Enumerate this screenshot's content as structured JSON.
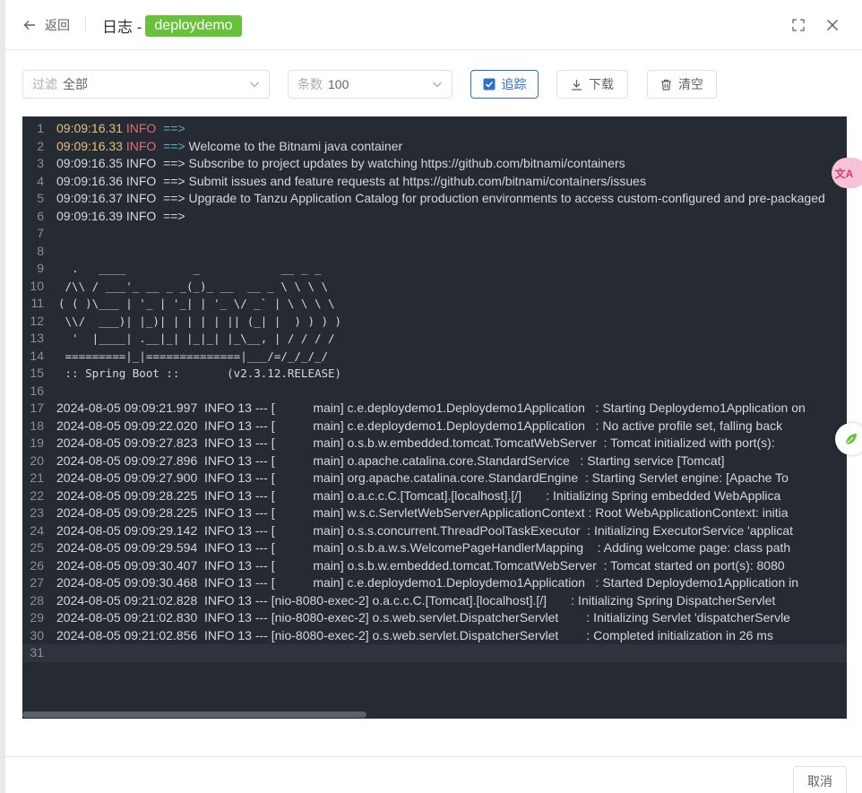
{
  "header": {
    "back_label": "返回",
    "title": "日志 -",
    "tag": "deploydemo",
    "tag_color": "#67c23a"
  },
  "toolbar": {
    "filter": {
      "label": "过滤",
      "value": "全部"
    },
    "count": {
      "label": "条数",
      "value": "100"
    },
    "follow_label": "追踪",
    "download_label": "下载",
    "clear_label": "清空",
    "accent_color": "#2f6fce"
  },
  "log": {
    "background": "#262a33",
    "lines": [
      {
        "n": "1",
        "ts": "09:09:16.31",
        "lvl": "INFO",
        "arrow": "==>",
        "text": "",
        "style": "color"
      },
      {
        "n": "2",
        "ts": "09:09:16.33",
        "lvl": "INFO",
        "arrow": "==>",
        "text": " Welcome to the Bitnami java container",
        "style": "color"
      },
      {
        "n": "3",
        "text": "09:09:16.35 INFO  ==> Subscribe to project updates by watching https://github.com/bitnami/containers"
      },
      {
        "n": "4",
        "text": "09:09:16.36 INFO  ==> Submit issues and feature requests at https://github.com/bitnami/containers/issues"
      },
      {
        "n": "5",
        "text": "09:09:16.37 INFO  ==> Upgrade to Tanzu Application Catalog for production environments to access custom-configured and pre-packaged"
      },
      {
        "n": "6",
        "text": "09:09:16.39 INFO  ==>"
      },
      {
        "n": "7",
        "text": ""
      },
      {
        "n": "8",
        "text": ""
      },
      {
        "n": "9",
        "text": "  .   ____          _            __ _ _",
        "banner": true
      },
      {
        "n": "10",
        "text": " /\\\\ / ___'_ __ _ _(_)_ __  __ _ \\ \\ \\ \\",
        "banner": true
      },
      {
        "n": "11",
        "text": "( ( )\\___ | '_ | '_| | '_ \\/ _` | \\ \\ \\ \\",
        "banner": true
      },
      {
        "n": "12",
        "text": " \\\\/  ___)| |_)| | | | | || (_| |  ) ) ) )",
        "banner": true
      },
      {
        "n": "13",
        "text": "  '  |____| .__|_| |_|_| |_\\__, | / / / /",
        "banner": true
      },
      {
        "n": "14",
        "text": " =========|_|==============|___/=/_/_/_/",
        "banner": true
      },
      {
        "n": "15",
        "text": " :: Spring Boot ::       (v2.3.12.RELEASE)",
        "banner": true
      },
      {
        "n": "16",
        "text": ""
      },
      {
        "n": "17",
        "text": "2024-08-05 09:09:21.997  INFO 13 --- [           main] c.e.deploydemo1.Deploydemo1Application   : Starting Deploydemo1Application on"
      },
      {
        "n": "18",
        "text": "2024-08-05 09:09:22.020  INFO 13 --- [           main] c.e.deploydemo1.Deploydemo1Application   : No active profile set, falling back"
      },
      {
        "n": "19",
        "text": "2024-08-05 09:09:27.823  INFO 13 --- [           main] o.s.b.w.embedded.tomcat.TomcatWebServer  : Tomcat initialized with port(s):"
      },
      {
        "n": "20",
        "text": "2024-08-05 09:09:27.896  INFO 13 --- [           main] o.apache.catalina.core.StandardService   : Starting service [Tomcat]"
      },
      {
        "n": "21",
        "text": "2024-08-05 09:09:27.900  INFO 13 --- [           main] org.apache.catalina.core.StandardEngine  : Starting Servlet engine: [Apache To"
      },
      {
        "n": "22",
        "text": "2024-08-05 09:09:28.225  INFO 13 --- [           main] o.a.c.c.C.[Tomcat].[localhost].[/]       : Initializing Spring embedded WebApplica"
      },
      {
        "n": "23",
        "text": "2024-08-05 09:09:28.225  INFO 13 --- [           main] w.s.c.ServletWebServerApplicationContext : Root WebApplicationContext: initia"
      },
      {
        "n": "24",
        "text": "2024-08-05 09:09:29.142  INFO 13 --- [           main] o.s.s.concurrent.ThreadPoolTaskExecutor  : Initializing ExecutorService 'applicat"
      },
      {
        "n": "25",
        "text": "2024-08-05 09:09:29.594  INFO 13 --- [           main] o.s.b.a.w.s.WelcomePageHandlerMapping    : Adding welcome page: class path"
      },
      {
        "n": "26",
        "text": "2024-08-05 09:09:30.407  INFO 13 --- [           main] o.s.b.w.embedded.tomcat.TomcatWebServer  : Tomcat started on port(s): 8080"
      },
      {
        "n": "27",
        "text": "2024-08-05 09:09:30.468  INFO 13 --- [           main] c.e.deploydemo1.Deploydemo1Application   : Started Deploydemo1Application in"
      },
      {
        "n": "28",
        "text": "2024-08-05 09:21:02.828  INFO 13 --- [nio-8080-exec-2] o.a.c.c.C.[Tomcat].[localhost].[/]       : Initializing Spring DispatcherServlet"
      },
      {
        "n": "29",
        "text": "2024-08-05 09:21:02.830  INFO 13 --- [nio-8080-exec-2] o.s.web.servlet.DispatcherServlet        : Initializing Servlet 'dispatcherServle"
      },
      {
        "n": "30",
        "text": "2024-08-05 09:21:02.856  INFO 13 --- [nio-8080-exec-2] o.s.web.servlet.DispatcherServlet        : Completed initialization in 26 ms"
      },
      {
        "n": "31",
        "text": "",
        "current": true
      }
    ]
  },
  "footer": {
    "cancel_label": "取消"
  },
  "widgets": {
    "translate_glyph": "文A"
  }
}
